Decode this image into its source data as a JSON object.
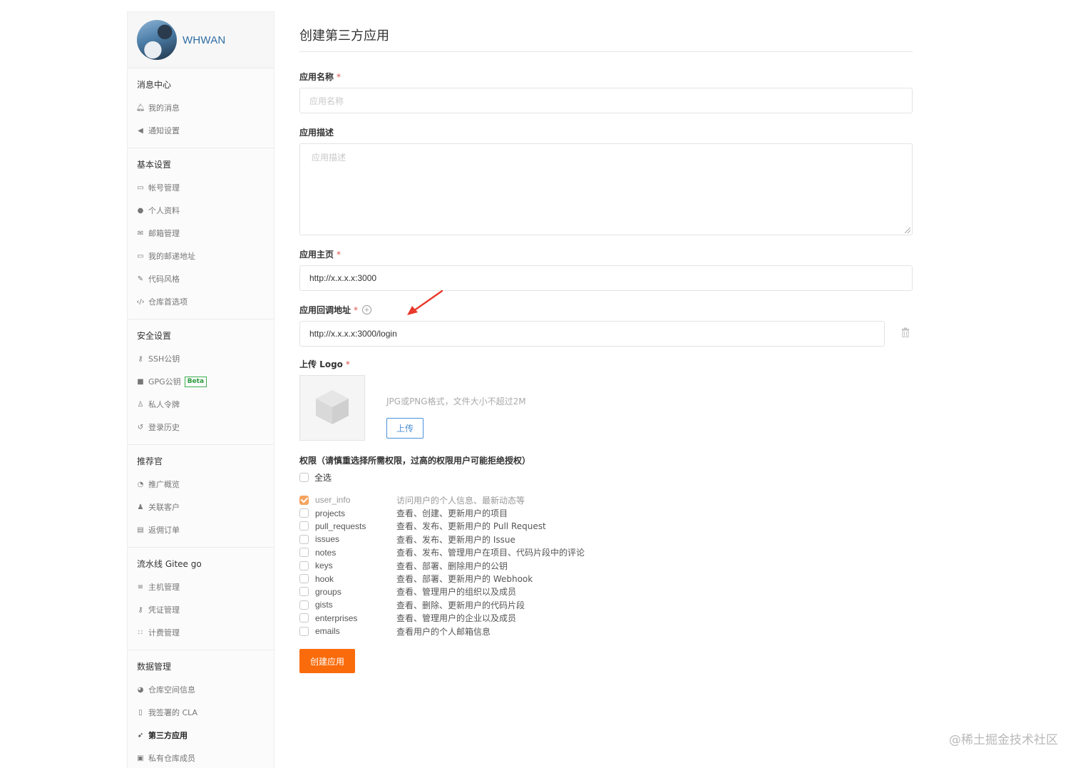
{
  "user": {
    "name": "WHWAN"
  },
  "sidebar": {
    "groups": [
      {
        "title": "消息中心",
        "items": [
          {
            "label": "我的消息",
            "icon": "bell-icon"
          },
          {
            "label": "通知设置",
            "icon": "volume-icon"
          }
        ]
      },
      {
        "title": "基本设置",
        "items": [
          {
            "label": "帐号管理",
            "icon": "id-card-icon"
          },
          {
            "label": "个人资料",
            "icon": "user-icon"
          },
          {
            "label": "邮箱管理",
            "icon": "envelope-icon"
          },
          {
            "label": "我的邮递地址",
            "icon": "address-card-icon"
          },
          {
            "label": "代码风格",
            "icon": "brush-icon"
          },
          {
            "label": "仓库首选项",
            "icon": "code-icon"
          }
        ]
      },
      {
        "title": "安全设置",
        "items": [
          {
            "label": "SSH公钥",
            "icon": "key-icon"
          },
          {
            "label": "GPG公钥",
            "icon": "lock-icon",
            "badge": "Beta"
          },
          {
            "label": "私人令牌",
            "icon": "token-icon"
          },
          {
            "label": "登录历史",
            "icon": "history-icon"
          }
        ]
      },
      {
        "title": "推荐官",
        "items": [
          {
            "label": "推广概览",
            "icon": "dashboard-icon"
          },
          {
            "label": "关联客户",
            "icon": "user-link-icon"
          },
          {
            "label": "返佣订单",
            "icon": "order-icon"
          }
        ]
      },
      {
        "title": "流水线 Gitee go",
        "items": [
          {
            "label": "主机管理",
            "icon": "server-icon"
          },
          {
            "label": "凭证管理",
            "icon": "key-icon"
          },
          {
            "label": "计费管理",
            "icon": "billing-icon"
          }
        ]
      },
      {
        "title": "数据管理",
        "items": [
          {
            "label": "仓库空间信息",
            "icon": "pie-chart-icon"
          },
          {
            "label": "我签署的 CLA",
            "icon": "document-icon"
          },
          {
            "label": "第三方应用",
            "icon": "rocket-icon",
            "active": true
          },
          {
            "label": "私有仓库成员",
            "icon": "members-icon"
          }
        ]
      }
    ]
  },
  "form": {
    "title": "创建第三方应用",
    "required_mark": "*",
    "app_name": {
      "label": "应用名称",
      "placeholder": "应用名称",
      "value": ""
    },
    "app_desc": {
      "label": "应用描述",
      "placeholder": "应用描述",
      "value": ""
    },
    "homepage": {
      "label": "应用主页",
      "value": "http://x.x.x.x:3000"
    },
    "callback": {
      "label": "应用回调地址",
      "help": "+",
      "value": "http://x.x.x.x:3000/login"
    },
    "logo": {
      "label": "上传 Logo",
      "hint": "JPG或PNG格式，文件大小不超过2M",
      "button": "上传"
    },
    "permissions": {
      "title": "权限（请慎重选择所需权限，过高的权限用户可能拒绝授权）",
      "select_all": "全选",
      "items": [
        {
          "name": "user_info",
          "desc": "访问用户的个人信息、最新动态等",
          "checked": true
        },
        {
          "name": "projects",
          "desc": "查看、创建、更新用户的项目",
          "checked": false
        },
        {
          "name": "pull_requests",
          "desc": "查看、发布、更新用户的 Pull Request",
          "checked": false
        },
        {
          "name": "issues",
          "desc": "查看、发布、更新用户的 Issue",
          "checked": false
        },
        {
          "name": "notes",
          "desc": "查看、发布、管理用户在项目、代码片段中的评论",
          "checked": false
        },
        {
          "name": "keys",
          "desc": "查看、部署、删除用户的公钥",
          "checked": false
        },
        {
          "name": "hook",
          "desc": "查看、部署、更新用户的 Webhook",
          "checked": false
        },
        {
          "name": "groups",
          "desc": "查看、管理用户的组织以及成员",
          "checked": false
        },
        {
          "name": "gists",
          "desc": "查看、删除、更新用户的代码片段",
          "checked": false
        },
        {
          "name": "enterprises",
          "desc": "查看、管理用户的企业以及成员",
          "checked": false
        },
        {
          "name": "emails",
          "desc": "查看用户的个人邮箱信息",
          "checked": false
        }
      ]
    },
    "submit": "创建应用"
  },
  "watermark": "@稀土掘金技术社区",
  "colors": {
    "accent": "#fa6b0b",
    "link": "#2e6da4",
    "checked": "#f4a460",
    "arrow": "#e8392b"
  }
}
